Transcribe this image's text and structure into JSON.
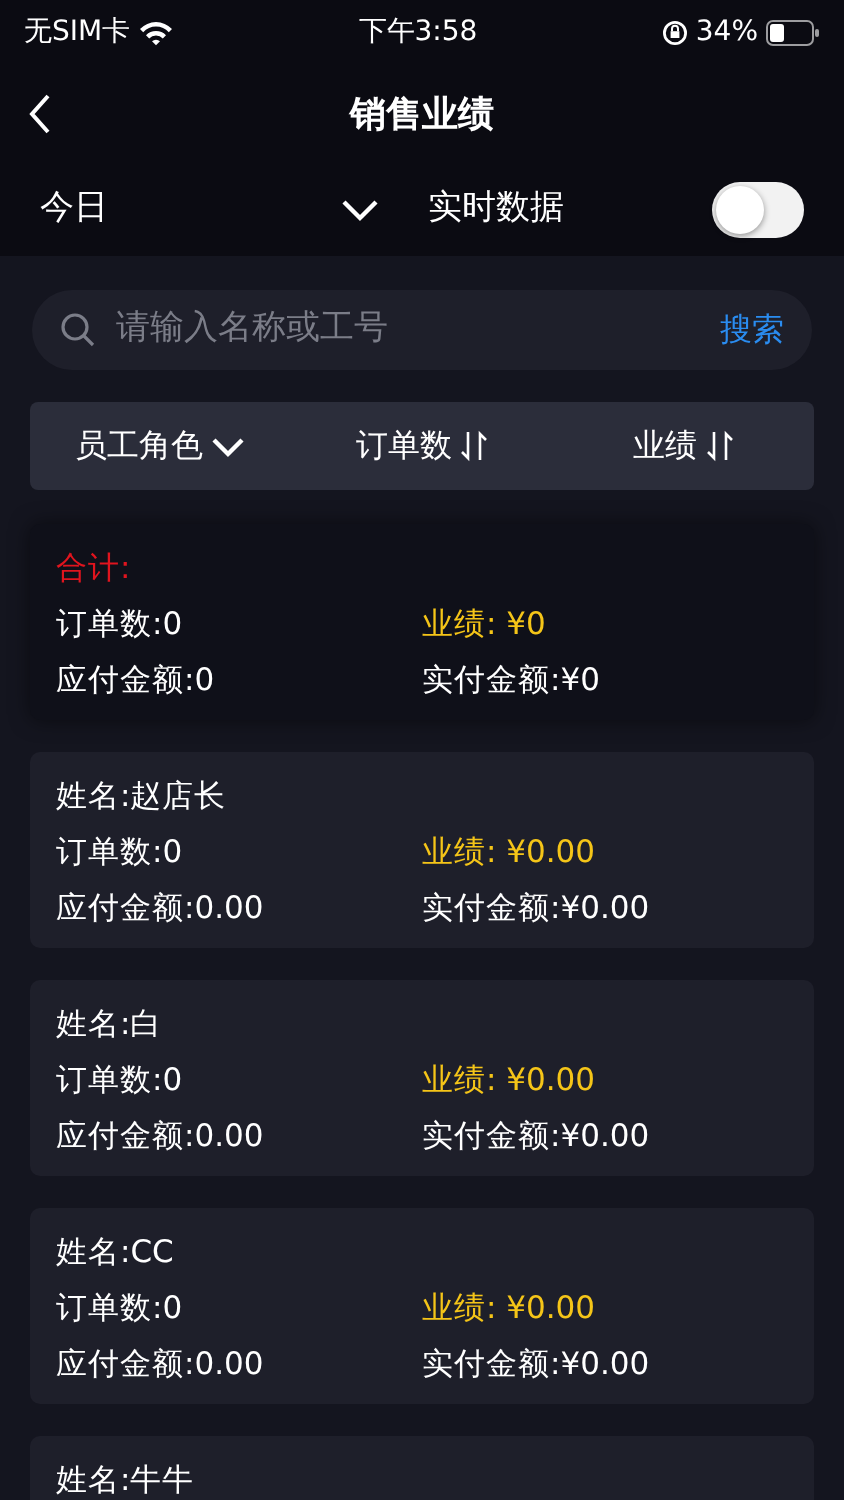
{
  "status_bar": {
    "carrier": "无SIM卡",
    "time": "下午3:58",
    "battery": "34%"
  },
  "nav": {
    "title": "销售业绩"
  },
  "filter": {
    "period": "今日",
    "realtime_label": "实时数据",
    "realtime_on": false
  },
  "search": {
    "placeholder": "请输入名称或工号",
    "button": "搜索"
  },
  "sort_bar": [
    {
      "label": "员工角色",
      "kind": "dropdown"
    },
    {
      "label": "订单数",
      "kind": "sort"
    },
    {
      "label": "业绩",
      "kind": "sort"
    }
  ],
  "total": {
    "title": "合计:",
    "orders": "订单数:0",
    "performance": "业绩: ¥0",
    "payable": "应付金额:0",
    "paid": "实付金额:¥0"
  },
  "employees": [
    {
      "name": "姓名:赵店长",
      "orders": "订单数:0",
      "performance": "业绩: ¥0.00",
      "payable": "应付金额:0.00",
      "paid": "实付金额:¥0.00"
    },
    {
      "name": "姓名:白",
      "orders": "订单数:0",
      "performance": "业绩: ¥0.00",
      "payable": "应付金额:0.00",
      "paid": "实付金额:¥0.00"
    },
    {
      "name": "姓名:CC",
      "orders": "订单数:0",
      "performance": "业绩: ¥0.00",
      "payable": "应付金额:0.00",
      "paid": "实付金额:¥0.00"
    },
    {
      "name": "姓名:牛牛"
    }
  ]
}
